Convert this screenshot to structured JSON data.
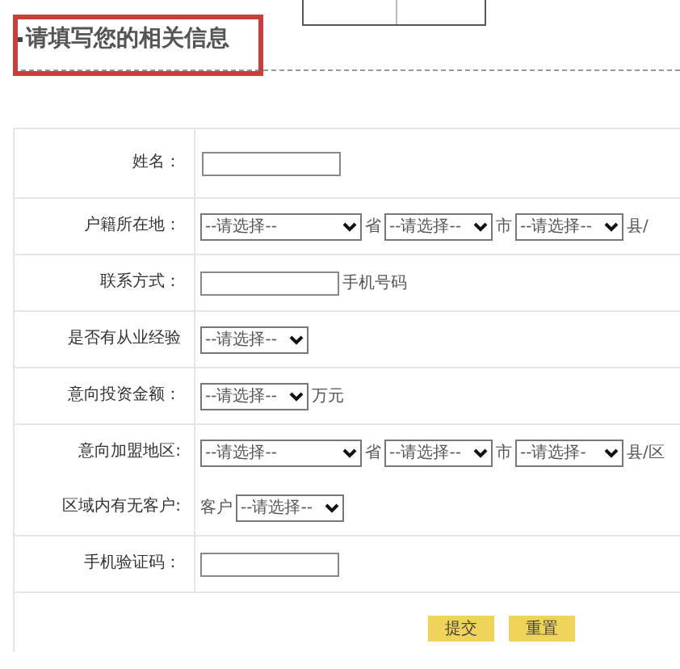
{
  "section_title": "请填写您的相关信息",
  "highlighted": true,
  "rows": [
    {
      "lines": [
        {
          "label": "姓名：",
          "items": [
            {
              "kind": "input"
            }
          ]
        }
      ]
    },
    {
      "lines": [
        {
          "label": "户籍所在地：",
          "items": [
            {
              "kind": "wideselect",
              "text": "--请选择--"
            },
            {
              "kind": "text",
              "text": "省"
            },
            {
              "kind": "select",
              "text": "--请选择--"
            },
            {
              "kind": "text",
              "text": "市"
            },
            {
              "kind": "select",
              "text": "--请选择--"
            },
            {
              "kind": "text",
              "text": "县/"
            }
          ]
        }
      ]
    },
    {
      "lines": [
        {
          "label": "联系方式：",
          "items": [
            {
              "kind": "input"
            },
            {
              "kind": "text",
              "text": "手机号码"
            }
          ]
        }
      ]
    },
    {
      "lines": [
        {
          "label": "是否有从业经验",
          "items": [
            {
              "kind": "select",
              "text": "--请选择--"
            }
          ]
        }
      ]
    },
    {
      "lines": [
        {
          "label": "意向投资金额：",
          "items": [
            {
              "kind": "select",
              "text": "--请选择--"
            },
            {
              "kind": "text",
              "text": "万元"
            }
          ]
        }
      ]
    },
    {
      "lines": [
        {
          "label": "意向加盟地区:",
          "items": [
            {
              "kind": "wideselect",
              "text": "--请选择--"
            },
            {
              "kind": "text",
              "text": "省"
            },
            {
              "kind": "select",
              "text": "--请选择--"
            },
            {
              "kind": "text",
              "text": "市"
            },
            {
              "kind": "select",
              "text": "--请选择-"
            },
            {
              "kind": "text",
              "text": "县/区"
            }
          ]
        },
        {
          "label": "区域内有无客户:",
          "items": [
            {
              "kind": "text",
              "text": "客户"
            },
            {
              "kind": "select",
              "text": "--请选择--"
            }
          ]
        }
      ]
    },
    {
      "lines": [
        {
          "label": "手机验证码：",
          "items": [
            {
              "kind": "input"
            }
          ]
        }
      ]
    }
  ],
  "buttons": [
    "提交",
    "重置"
  ]
}
